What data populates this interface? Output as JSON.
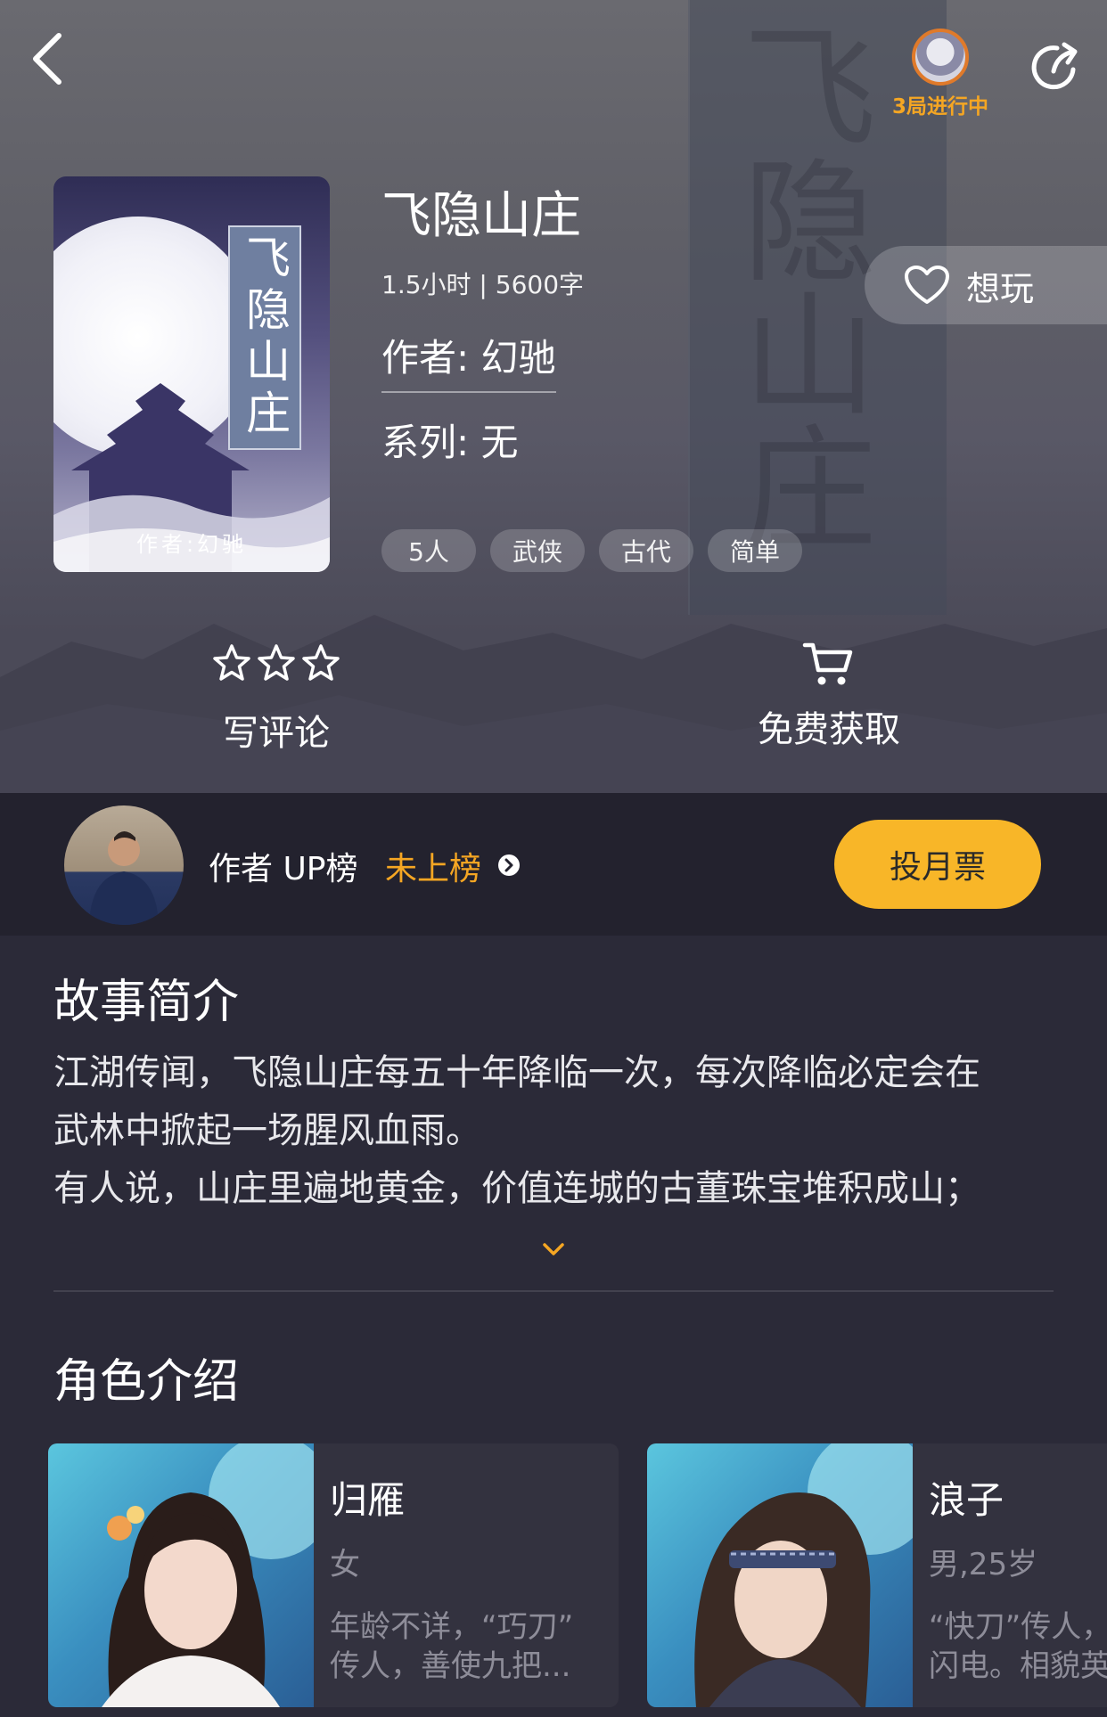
{
  "header": {
    "progress_label": "3局进行中"
  },
  "cover": {
    "title_art": "飞隐山庄",
    "author_art": "作者:幻驰"
  },
  "game": {
    "title": "飞隐山庄",
    "meta": "1.5小时 | 5600字",
    "author": "作者: 幻驰",
    "series": "系列: 无",
    "tags": [
      "5人",
      "武侠",
      "古代",
      "简单"
    ],
    "want_label": "想玩"
  },
  "actions": {
    "review_label": "写评论",
    "get_label": "免费获取"
  },
  "author_rank": {
    "label": "作者 UP榜",
    "value": "未上榜",
    "vote_label": "投月票"
  },
  "story": {
    "title": "故事简介",
    "lines": [
      "江湖传闻，飞隐山庄每五十年降临一次，每次降临必定会在",
      "武林中掀起一场腥风血雨。",
      "有人说，山庄里遍地黄金，价值连城的古董珠宝堆积成山；"
    ]
  },
  "roles": {
    "title": "角色介绍",
    "items": [
      {
        "name": "归雁",
        "gender": "女",
        "desc_line1": "年龄不详，“巧刀”",
        "desc_line2": "传人，善使九把..."
      },
      {
        "name": "浪子",
        "gender": "男,25岁",
        "desc_line1": "“快刀”传人，",
        "desc_line2": "闪电。相貌英"
      }
    ]
  },
  "colors": {
    "accent": "#f5a623",
    "vote_button": "#f8b628",
    "background": "#2b2a38",
    "author_bar": "#23222e"
  },
  "icons": [
    "back-icon",
    "share-icon",
    "heart-icon",
    "star-outline-icon",
    "cart-icon",
    "chevron-right-circle-icon",
    "chevron-down-icon"
  ]
}
